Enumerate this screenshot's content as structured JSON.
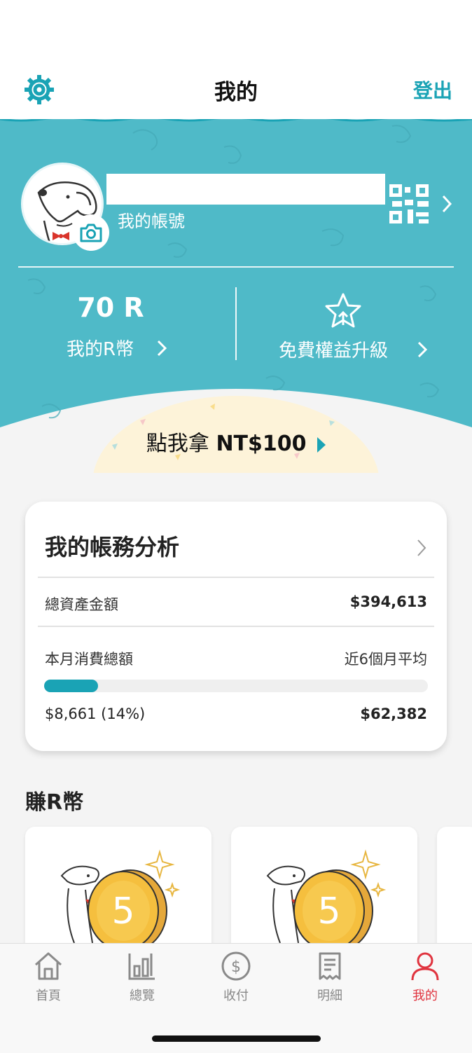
{
  "header": {
    "title": "我的",
    "logout_label": "登出"
  },
  "profile": {
    "account_label": "我的帳號",
    "r_coin_value": "70 R",
    "r_coin_label": "我的R幣",
    "upgrade_label": "免費權益升級",
    "promo_prefix": "點我拿",
    "promo_amount": "NT$100"
  },
  "analysis": {
    "title": "我的帳務分析",
    "total_assets_label": "總資產金額",
    "total_assets_value": "$394,613",
    "monthly_spend_label": "本月消費總額",
    "avg_label": "近6個月平均",
    "spend_value": "$8,661 (14%)",
    "avg_value": "$62,382",
    "progress_fraction": 0.14
  },
  "earn": {
    "title": "賺R幣",
    "coin_number": "5"
  },
  "nav": {
    "items": [
      {
        "label": "首頁"
      },
      {
        "label": "總覽"
      },
      {
        "label": "收付"
      },
      {
        "label": "明細"
      },
      {
        "label": "我的"
      }
    ],
    "active_color": "#e0343f",
    "inactive_color": "#888888"
  },
  "colors": {
    "accent": "#1aa3b5",
    "header_bg": "#4fbac8",
    "promo_bg": "#fdf3d9"
  }
}
